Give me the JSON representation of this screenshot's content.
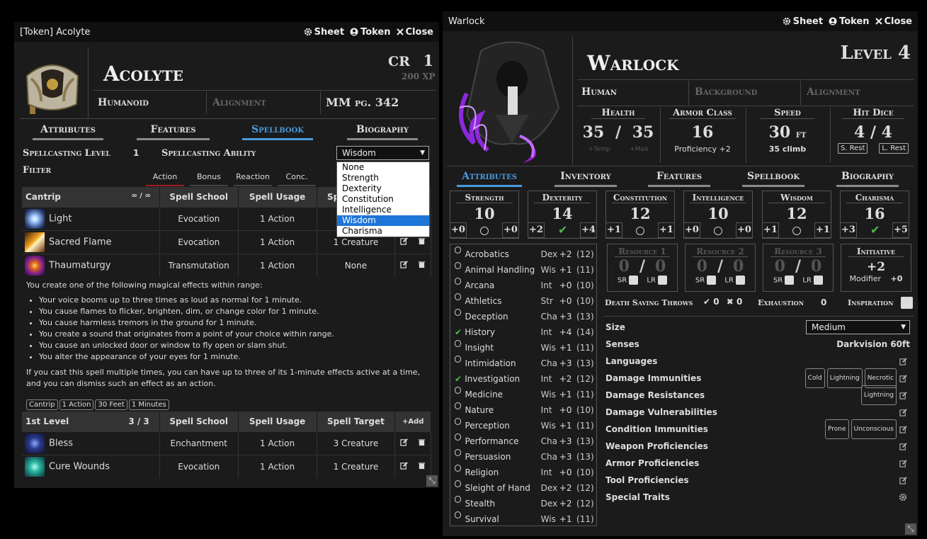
{
  "left": {
    "title": "[Token] Acolyte",
    "sheet": "Sheet",
    "token": "Token",
    "close": "Close",
    "name": "Acolyte",
    "cr_label": "CR",
    "cr": "1",
    "xp": "200 XP",
    "type": "Humanoid",
    "alignment": "Alignment",
    "source": "MM pg. 342",
    "tabs": [
      "Attributes",
      "Features",
      "Spellbook",
      "Biography"
    ],
    "spellcasting_level_label": "Spellcasting Level",
    "spellcasting_level": "1",
    "spellcasting_ability_label": "Spellcasting Ability",
    "spellcasting_ability": "Wisdom",
    "ability_options": [
      "None",
      "Strength",
      "Dexterity",
      "Constitution",
      "Intelligence",
      "Wisdom",
      "Charisma"
    ],
    "filter_label": "Filter",
    "filters": [
      "Action",
      "Bonus",
      "Reaction",
      "Conc."
    ],
    "cantrip": {
      "header": "Cantrip",
      "slots": "∞ / ∞",
      "cols": [
        "Spell School",
        "Spell Usage",
        "Spell Target"
      ],
      "spells": [
        {
          "name": "Light",
          "school": "Evocation",
          "usage": "1 Action",
          "target": ""
        },
        {
          "name": "Sacred Flame",
          "school": "Evocation",
          "usage": "1 Action",
          "target": "1 Creature"
        },
        {
          "name": "Thaumaturgy",
          "school": "Transmutation",
          "usage": "1 Action",
          "target": "None"
        }
      ]
    },
    "desc_intro": "You create one of the following magical effects within range:",
    "desc_bullets": [
      "Your voice booms up to three times as loud as normal for 1 minute.",
      "You cause flames to flicker, brighten, dim, or change color for 1 minute.",
      "You cause harmless tremors in the ground for 1 minute.",
      "You create a sound that originates from a point of your choice within range.",
      "You cause an unlocked door or window to fly open or slam shut.",
      "You alter the appearance of your eyes for 1 minute."
    ],
    "desc_outro": "If you cast this spell multiple times, you can have up to three of its 1-minute effects active at a time, and you can dismiss such an effect as an action.",
    "tags": [
      "Cantrip",
      "1 Action",
      "30 Feet",
      "1 Minutes"
    ],
    "level1": {
      "header": "1st Level",
      "slots": "3 / 3",
      "add": "Add",
      "cols": [
        "Spell School",
        "Spell Usage",
        "Spell Target"
      ],
      "spells": [
        {
          "name": "Bless",
          "school": "Enchantment",
          "usage": "1 Action",
          "target": "3 Creature"
        },
        {
          "name": "Cure Wounds",
          "school": "Evocation",
          "usage": "1 Action",
          "target": "1 Creature"
        }
      ]
    }
  },
  "right": {
    "title": "Warlock",
    "sheet": "Sheet",
    "token": "Token",
    "close": "Close",
    "name": "Warlock",
    "level": "Level 4",
    "race": "Human",
    "background": "Background",
    "alignment": "Alignment",
    "health_label": "Health",
    "hp": "35",
    "hp_max": "35",
    "hp_sep": "/",
    "temp": "+Temp",
    "max": "+Max",
    "ac_label": "Armor Class",
    "ac": "16",
    "ac_sub": "Proficiency +2",
    "speed_label": "Speed",
    "speed": "30",
    "speed_unit": "ft",
    "speed_sub": "35 climb",
    "hitdice_label": "Hit Dice",
    "hitdice": "4 / 4",
    "short_rest": "S. Rest",
    "long_rest": "L. Rest",
    "tabs": [
      "Attributes",
      "Inventory",
      "Features",
      "Spellbook",
      "Biography"
    ],
    "abilities": [
      {
        "name": "Strength",
        "value": "10",
        "save": "+0",
        "mod": "+0",
        "prof": false
      },
      {
        "name": "Dexterity",
        "value": "14",
        "save": "+2",
        "mod": "+4",
        "prof": true
      },
      {
        "name": "Constitution",
        "value": "12",
        "save": "+1",
        "mod": "+1",
        "prof": false
      },
      {
        "name": "Intelligence",
        "value": "10",
        "save": "+0",
        "mod": "+0",
        "prof": false
      },
      {
        "name": "Wisdom",
        "value": "12",
        "save": "+1",
        "mod": "+1",
        "prof": false
      },
      {
        "name": "Charisma",
        "value": "16",
        "save": "+3",
        "mod": "+5",
        "prof": true
      }
    ],
    "skills": [
      {
        "name": "Acrobatics",
        "abil": "Dex",
        "mod": "+2",
        "pass": "(12)",
        "prof": false
      },
      {
        "name": "Animal Handling",
        "abil": "Wis",
        "mod": "+1",
        "pass": "(11)",
        "prof": false
      },
      {
        "name": "Arcana",
        "abil": "Int",
        "mod": "+0",
        "pass": "(10)",
        "prof": false
      },
      {
        "name": "Athletics",
        "abil": "Str",
        "mod": "+0",
        "pass": "(10)",
        "prof": false
      },
      {
        "name": "Deception",
        "abil": "Cha",
        "mod": "+3",
        "pass": "(13)",
        "prof": false
      },
      {
        "name": "History",
        "abil": "Int",
        "mod": "+4",
        "pass": "(14)",
        "prof": true
      },
      {
        "name": "Insight",
        "abil": "Wis",
        "mod": "+1",
        "pass": "(11)",
        "prof": false
      },
      {
        "name": "Intimidation",
        "abil": "Cha",
        "mod": "+3",
        "pass": "(13)",
        "prof": false
      },
      {
        "name": "Investigation",
        "abil": "Int",
        "mod": "+2",
        "pass": "(12)",
        "prof": true
      },
      {
        "name": "Medicine",
        "abil": "Wis",
        "mod": "+1",
        "pass": "(11)",
        "prof": false
      },
      {
        "name": "Nature",
        "abil": "Int",
        "mod": "+0",
        "pass": "(10)",
        "prof": false
      },
      {
        "name": "Perception",
        "abil": "Wis",
        "mod": "+1",
        "pass": "(11)",
        "prof": false
      },
      {
        "name": "Performance",
        "abil": "Cha",
        "mod": "+3",
        "pass": "(13)",
        "prof": false
      },
      {
        "name": "Persuasion",
        "abil": "Cha",
        "mod": "+3",
        "pass": "(13)",
        "prof": false
      },
      {
        "name": "Religion",
        "abil": "Int",
        "mod": "+0",
        "pass": "(10)",
        "prof": false
      },
      {
        "name": "Sleight of Hand",
        "abil": "Dex",
        "mod": "+2",
        "pass": "(12)",
        "prof": false
      },
      {
        "name": "Stealth",
        "abil": "Dex",
        "mod": "+2",
        "pass": "(12)",
        "prof": false
      },
      {
        "name": "Survival",
        "abil": "Wis",
        "mod": "+1",
        "pass": "(11)",
        "prof": false
      }
    ],
    "resources": [
      {
        "name": "Resource 1",
        "value": "0",
        "max": "0",
        "sep": "/"
      },
      {
        "name": "Resource 2",
        "value": "0",
        "max": "0",
        "sep": "/"
      },
      {
        "name": "Resource 3",
        "value": "0",
        "max": "0",
        "sep": "/"
      }
    ],
    "sr": "SR",
    "lr": "LR",
    "initiative_label": "Initiative",
    "initiative": "+2",
    "initiative_mod_label": "Modifier",
    "initiative_mod": "+0",
    "death_saves_label": "Death Saving Throws",
    "death_success": "0",
    "death_fail": "0",
    "exhaustion_label": "Exhaustion",
    "exhaustion": "0",
    "inspiration_label": "Inspiration",
    "size_label": "Size",
    "size": "Medium",
    "senses_label": "Senses",
    "senses": "Darkvision 60ft",
    "traits": [
      {
        "label": "Languages",
        "chips": []
      },
      {
        "label": "Damage Immunities",
        "chips": [
          "Cold",
          "Lightning",
          "Necrotic"
        ]
      },
      {
        "label": "Damage Resistances",
        "chips": [
          "Lightning"
        ]
      },
      {
        "label": "Damage Vulnerabilities",
        "chips": []
      },
      {
        "label": "Condition Immunities",
        "chips": [
          "Prone",
          "Unconscious"
        ]
      },
      {
        "label": "Weapon Proficiencies",
        "chips": []
      },
      {
        "label": "Armor Proficiencies",
        "chips": []
      },
      {
        "label": "Tool Proficiencies",
        "chips": []
      }
    ],
    "special_traits": "Special Traits"
  }
}
